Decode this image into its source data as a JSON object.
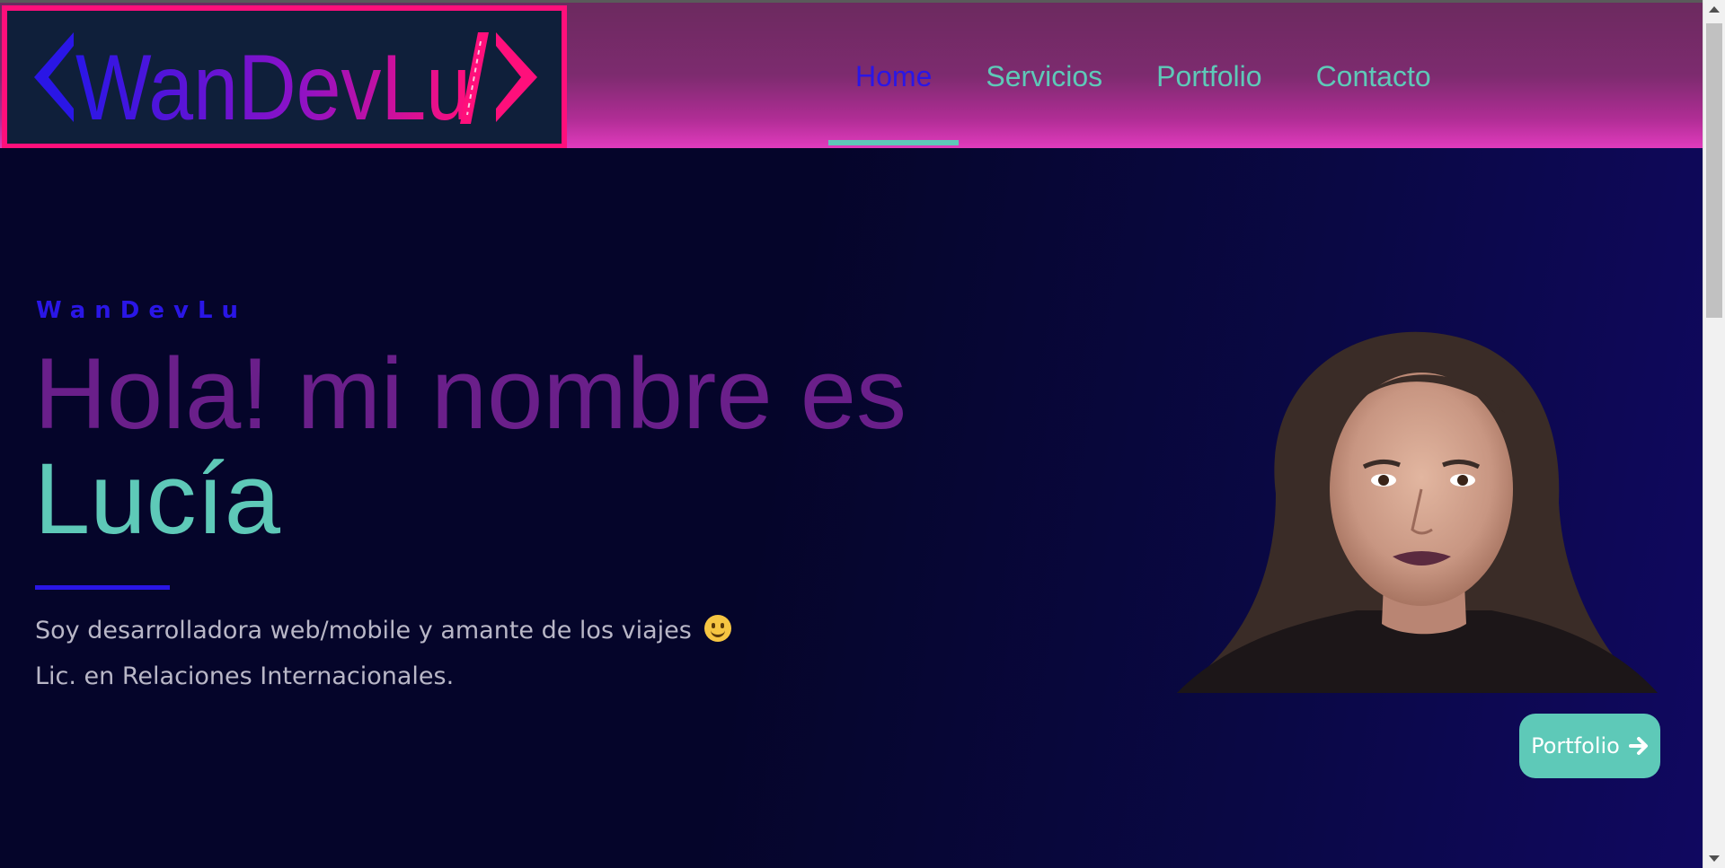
{
  "header": {
    "logo_text": "WanDevLu",
    "nav": [
      {
        "label": "Home",
        "active": true
      },
      {
        "label": "Servicios",
        "active": false
      },
      {
        "label": "Portfolio",
        "active": false
      },
      {
        "label": "Contacto",
        "active": false
      }
    ]
  },
  "hero": {
    "eyebrow": "WanDevLu",
    "headline": "Hola! mi nombre es",
    "name": "Lucía",
    "bio_line1": "Soy desarrolladora web/mobile y amante de los viajes",
    "bio_emoji": "slightly-smiling-face-icon",
    "bio_line2": "Lic. en Relaciones Internacionales.",
    "cta_label": "Portfolio",
    "cta_icon": "arrow-right-icon"
  },
  "colors": {
    "accent_teal": "#5ec9b8",
    "accent_blue": "#2a16e6",
    "accent_pink": "#ff0f7b",
    "headline_purple": "#6a1f8a",
    "background": "#05052a"
  }
}
